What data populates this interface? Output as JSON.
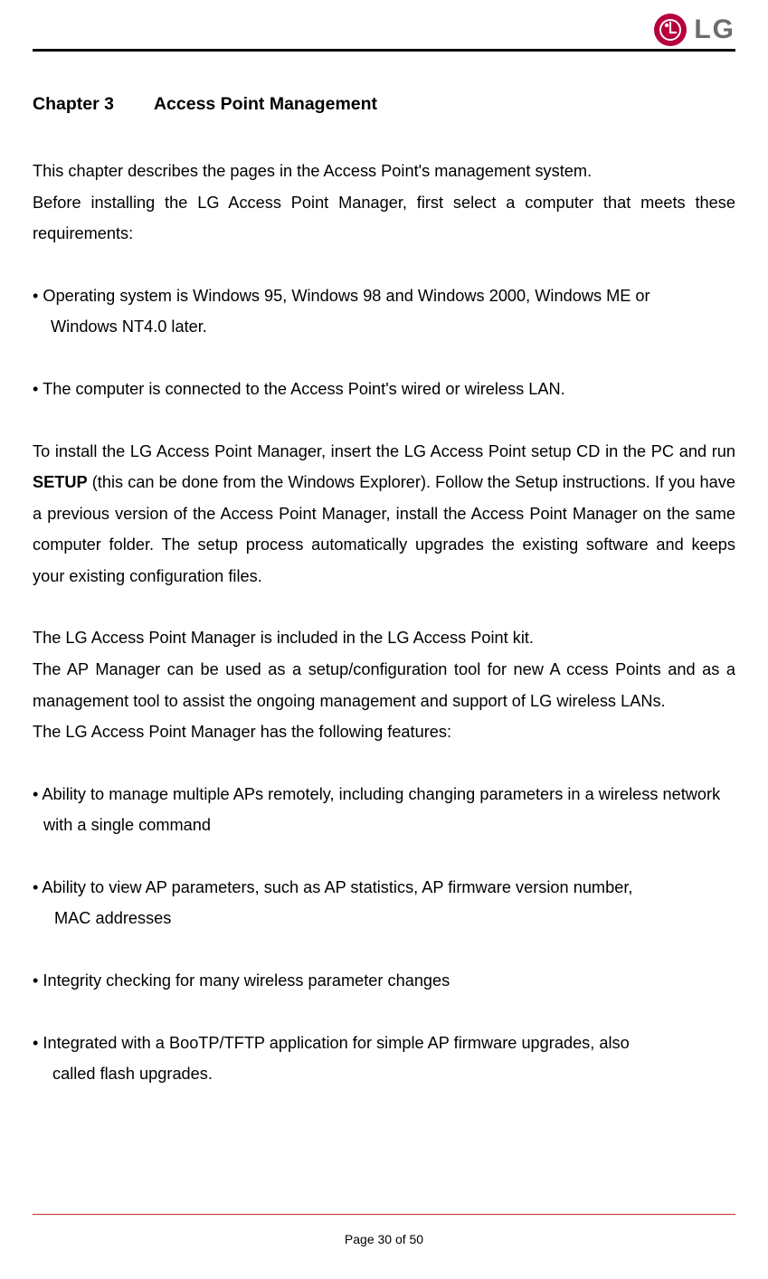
{
  "brand": "LG",
  "chapter": {
    "number": "Chapter 3",
    "title": "Access Point Management"
  },
  "intro1": "This chapter describes the pages in the Access Point's management system.",
  "intro2": "Before installing the LG Access Point Manager, first select a computer that meets these requirements:",
  "req1a": "• Operating system is Windows 95, Windows 98 and Windows  2000, Windows ME or",
  "req1b": "Windows NT4.0 later.",
  "req2": "• The computer is connected to the Access Point's wired or wireless LAN.",
  "install_a": "To install the LG Access Point Manager, insert the LG Access Point setup CD in the PC and run  ",
  "install_bold": "SETUP",
  "install_b": " (this can be done  from the Windows Explorer). Follow the Setup instructions. If you have a previous version of the Access Point Manager, install the Access Point Manager on the same computer folder. The setup process automatically upgrades the existing software and keeps your existing configuration files.",
  "kit": "The LG Access Point Manager is included in the LG Access Point kit.",
  "usage": "The AP Manager can be used as a setup/configuration tool for new A ccess Points and as a management tool to assist the ongoing management and support of LG wireless LANs.",
  "features_intro": "The LG Access Point Manager has the following features:",
  "feat1": "• Ability to manage multiple APs remotely, including changing parameters in a wireless network with a single command",
  "feat2a": "• Ability to view AP parameters, such as AP statistics, AP firmware version number,",
  "feat2b": "MAC addresses",
  "feat3": "• Integrity checking for many wireless parameter changes",
  "feat4a": "• Integrated with a BooTP/TFTP application for simple AP firmware upgrades, also",
  "feat4b": "called flash upgrades.",
  "footer": "Page 30 of 50"
}
